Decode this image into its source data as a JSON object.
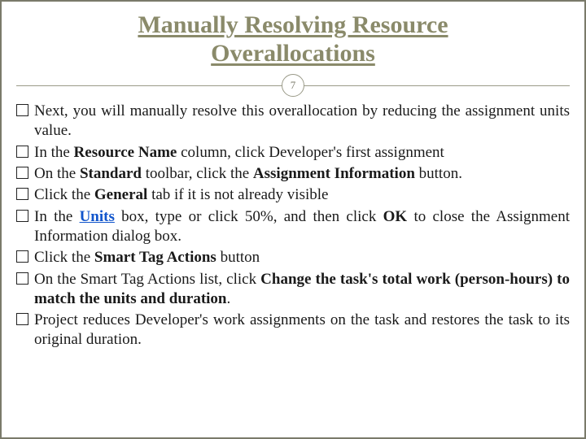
{
  "title": "Manually Resolving Resource\nOverallocations",
  "page_number": "7",
  "items": [
    {
      "segments": [
        {
          "text": "Next, you will manually resolve this overallocation by reducing the assignment units value."
        }
      ]
    },
    {
      "segments": [
        {
          "text": "In the "
        },
        {
          "text": "Resource Name",
          "bold": true
        },
        {
          "text": " column, click Developer's first assignment"
        }
      ]
    },
    {
      "segments": [
        {
          "text": "On the "
        },
        {
          "text": "Standard",
          "bold": true
        },
        {
          "text": " toolbar, click the "
        },
        {
          "text": "Assignment Information",
          "bold": true
        },
        {
          "text": " button."
        }
      ]
    },
    {
      "segments": [
        {
          "text": "Click the "
        },
        {
          "text": "General",
          "bold": true
        },
        {
          "text": " tab if it is not already visible"
        }
      ]
    },
    {
      "segments": [
        {
          "text": "In the "
        },
        {
          "text": "Units",
          "bold": true,
          "link": true
        },
        {
          "text": " box, type or click 50%, and then click "
        },
        {
          "text": "OK",
          "bold": true
        },
        {
          "text": " to close the Assignment Information dialog box."
        }
      ]
    },
    {
      "segments": [
        {
          "text": "Click the "
        },
        {
          "text": "Smart Tag Actions",
          "bold": true
        },
        {
          "text": " button"
        }
      ]
    },
    {
      "segments": [
        {
          "text": "On the Smart Tag Actions list, click "
        },
        {
          "text": "Change the task's total work (person-hours) to match the units and duration",
          "bold": true
        },
        {
          "text": "."
        }
      ]
    },
    {
      "segments": [
        {
          "text": "Project reduces Developer's work assignments on the task and restores the task to its original duration."
        }
      ]
    }
  ]
}
